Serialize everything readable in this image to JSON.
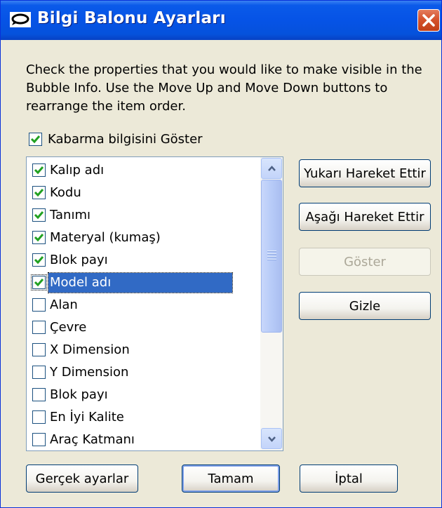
{
  "window": {
    "title": "Bilgi Balonu Ayarları"
  },
  "description": "Check the properties that you would like to make visible in the Bubble Info. Use the Move Up and Move Down buttons to rearrange the item order.",
  "show_bubble": {
    "label": "Kabarma bilgisini Göster",
    "checked": true
  },
  "list": {
    "items": [
      {
        "label": "Kalıp adı",
        "checked": true
      },
      {
        "label": "Kodu",
        "checked": true
      },
      {
        "label": "Tanımı",
        "checked": true
      },
      {
        "label": "Materyal (kumaş)",
        "checked": true
      },
      {
        "label": "Blok payı",
        "checked": true
      },
      {
        "label": "Model adı",
        "checked": true,
        "selected": true
      },
      {
        "label": "Alan",
        "checked": false
      },
      {
        "label": "Çevre",
        "checked": false
      },
      {
        "label": "X Dimension",
        "checked": false
      },
      {
        "label": "Y Dimension",
        "checked": false
      },
      {
        "label": "Blok payı",
        "checked": false
      },
      {
        "label": "En İyi Kalite",
        "checked": false
      },
      {
        "label": "Araç Katmanı",
        "checked": false
      }
    ]
  },
  "buttons": {
    "move_up": "Yukarı Hareket Ettir",
    "move_down": "Aşağı Hareket Ettir",
    "show": "Göster",
    "hide": "Gizle",
    "defaults": "Gerçek ayarlar",
    "ok": "Tamam",
    "cancel": "İptal"
  },
  "colors": {
    "title_bar": "#0653E6",
    "selection": "#316AC5",
    "check": "#21A121",
    "close": "#D5532D"
  },
  "icons": {
    "title": "bubble-icon",
    "close": "close-icon",
    "scroll_up": "chevron-up-icon",
    "scroll_down": "chevron-down-icon"
  }
}
